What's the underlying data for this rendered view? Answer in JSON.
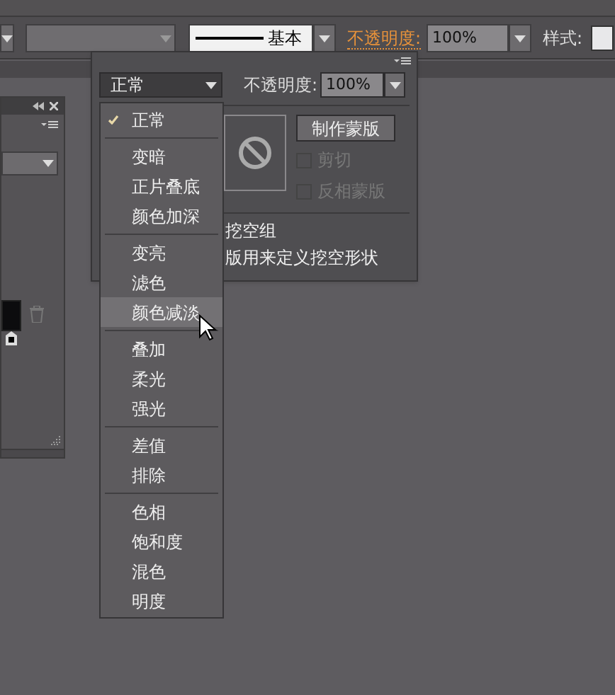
{
  "control_bar": {
    "stroke_style": "基本",
    "opacity_label": "不透明度:",
    "opacity_value": "100%",
    "style_label": "样式:"
  },
  "transparency_panel": {
    "blend_mode": "正常",
    "opacity_label": "不透明度:",
    "opacity_value": "100%",
    "make_mask_button": "制作蒙版",
    "options": [
      {
        "label": "剪切",
        "checked": false,
        "disabled": true
      },
      {
        "label": "反相蒙版",
        "checked": false,
        "disabled": true
      }
    ],
    "footer_texts": [
      "挖空组",
      "版用来定义挖空形状"
    ]
  },
  "blend_menu": {
    "groups": [
      [
        {
          "label": "正常",
          "checked": true,
          "highlighted": false
        }
      ],
      [
        {
          "label": "变暗",
          "checked": false,
          "highlighted": false
        },
        {
          "label": "正片叠底",
          "checked": false,
          "highlighted": false
        },
        {
          "label": "颜色加深",
          "checked": false,
          "highlighted": false
        }
      ],
      [
        {
          "label": "变亮",
          "checked": false,
          "highlighted": false
        },
        {
          "label": "滤色",
          "checked": false,
          "highlighted": false
        },
        {
          "label": "颜色减淡",
          "checked": false,
          "highlighted": true
        }
      ],
      [
        {
          "label": "叠加",
          "checked": false,
          "highlighted": false
        },
        {
          "label": "柔光",
          "checked": false,
          "highlighted": false
        },
        {
          "label": "强光",
          "checked": false,
          "highlighted": false
        }
      ],
      [
        {
          "label": "差值",
          "checked": false,
          "highlighted": false
        },
        {
          "label": "排除",
          "checked": false,
          "highlighted": false
        }
      ],
      [
        {
          "label": "色相",
          "checked": false,
          "highlighted": false
        },
        {
          "label": "饱和度",
          "checked": false,
          "highlighted": false
        },
        {
          "label": "混色",
          "checked": false,
          "highlighted": false
        },
        {
          "label": "明度",
          "checked": false,
          "highlighted": false
        }
      ]
    ]
  }
}
